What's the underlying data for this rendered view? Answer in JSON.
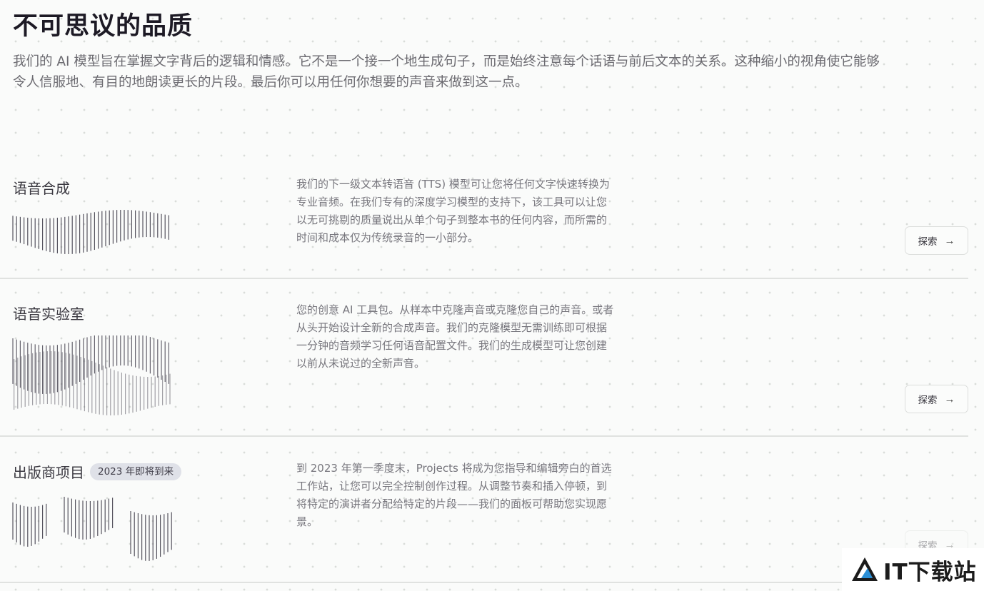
{
  "hero": {
    "title": "不可思议的品质",
    "description": "我们的 AI 模型旨在掌握文字背后的逻辑和情感。它不是一个接一个地生成句子，而是始终注意每个话语与前后文本的关系。这种缩小的视角使它能够令人信服地、有目的地朗读更长的片段。最后你可以用任何你想要的声音来做到这一点。"
  },
  "features": [
    {
      "title": "语音合成",
      "badge": "",
      "description": "我们的下一级文本转语音 (TTS) 模型可让您将任何文字快速转换为专业音频。在我们专有的深度学习模型的支持下，该工具可以让您以无可挑剔的质量说出从单个句子到整本书的任何内容，而所需的时间和成本仅为传统录音的一小部分。",
      "button_label": "探索",
      "button_icon": "arrow-right-icon"
    },
    {
      "title": "语音实验室",
      "badge": "",
      "description": "您的创意 AI 工具包。从样本中克隆声音或克隆您自己的声音。或者从头开始设计全新的合成声音。我们的克隆模型无需训练即可根据一分钟的音频学习任何语音配置文件。我们的生成模型可让您创建以前从未说过的全新声音。",
      "button_label": "探索",
      "button_icon": "arrow-right-icon"
    },
    {
      "title": "出版商项目",
      "badge": "2023 年即将到来",
      "description": "到 2023 年第一季度末，Projects 将成为您指导和编辑旁白的首选工作站，让您可以完全控制创作过程。从调整节奏和插入停顿，到将特定的演讲者分配给特定的片段——我们的面板可帮助您实现愿景。",
      "button_label": "探索",
      "button_icon": "arrow-right-icon"
    }
  ],
  "watermark": {
    "text": "IT下载站",
    "logo_icon": "triangle-logo-icon"
  },
  "colors": {
    "background": "#fafbfa",
    "title": "#1d1a25",
    "body_text": "#6b6a70",
    "badge_bg": "#dfe1e8",
    "divider": "#e0e2e0"
  }
}
